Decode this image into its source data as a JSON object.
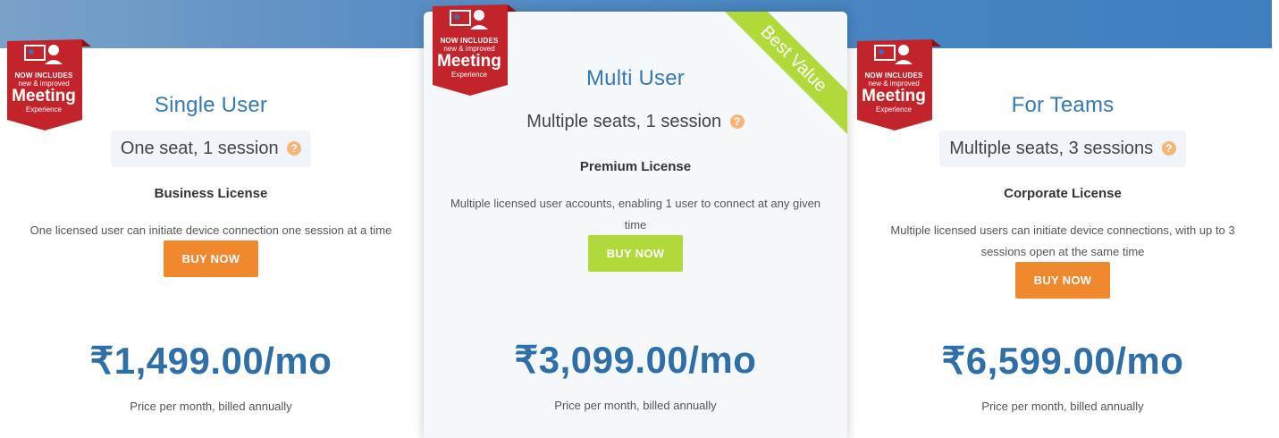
{
  "badge": {
    "line1": "NOW INCLUDES",
    "line2": "new & improved",
    "line3": "Meeting",
    "line4": "Experience"
  },
  "best_value": "Best Value",
  "plans": [
    {
      "title": "Single User",
      "seats": "One seat, 1 session",
      "license": "Business License",
      "description": "One licensed user can initiate device connection one session at a time",
      "button": "BUY NOW",
      "price": "₹1,499.00/mo",
      "note": "Price per month, billed annually"
    },
    {
      "title": "Multi User",
      "seats": "Multiple seats, 1 session",
      "license": "Premium License",
      "description_l1": "Multiple licensed user accounts, enabling 1 user to connect at any given",
      "description_l2": "time",
      "button": "BUY NOW",
      "price": "₹3,099.00/mo",
      "note": "Price per month, billed annually"
    },
    {
      "title": "For Teams",
      "seats": "Multiple seats, 3 sessions",
      "license": "Corporate License",
      "description_l1": "Multiple licensed users can initiate device connections, with up to 3",
      "description_l2": "sessions open at the same time",
      "button": "BUY NOW",
      "price": "₹6,599.00/mo",
      "note": "Price per month, billed annually"
    }
  ],
  "colors": {
    "title": "#3479b5",
    "price": "#2f6fa8",
    "buy_orange": "#f0892e",
    "buy_green": "#b2d93a",
    "badge_red": "#c3242b",
    "help": "#f6b57a"
  }
}
